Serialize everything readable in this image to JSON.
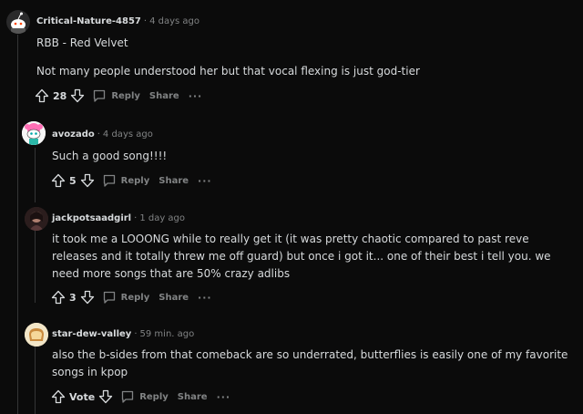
{
  "comments": [
    {
      "author": "Critical-Nature-4857",
      "time": "4 days ago",
      "lines": [
        "RBB - Red Velvet",
        "Not many people understood her but that vocal flexing is just god-tier"
      ],
      "votes": "28",
      "reply": "Reply",
      "share": "Share",
      "more": "···"
    },
    {
      "author": "avozado",
      "time": "4 days ago",
      "lines": [
        "Such a good song!!!!"
      ],
      "votes": "5",
      "reply": "Reply",
      "share": "Share",
      "more": "···"
    },
    {
      "author": "jackpotsaadgirl",
      "time": "1 day ago",
      "lines": [
        "it took me a LOOONG while to really get it (it was pretty chaotic compared to past reve releases and it totally threw me off guard) but once i got it... one of their best i tell you. we need more songs that are 50% crazy adlibs"
      ],
      "votes": "3",
      "reply": "Reply",
      "share": "Share",
      "more": "···"
    },
    {
      "author": "star-dew-valley",
      "time": "59 min. ago",
      "lines": [
        "also the b-sides from that comeback are so underrated, butterflies is easily one of my favorite songs in kpop"
      ],
      "votes": "Vote",
      "reply": "Reply",
      "share": "Share",
      "more": "···"
    }
  ],
  "separator": "·",
  "colors": {
    "background": "#0b0b0b",
    "text": "#d7dadc",
    "muted": "#818384",
    "thread_line": "#343536"
  }
}
